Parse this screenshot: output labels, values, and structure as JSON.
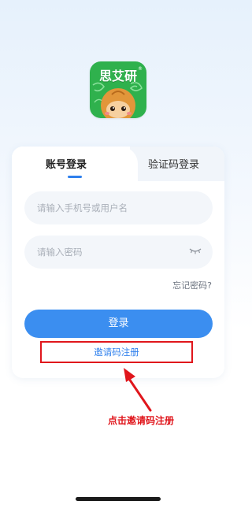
{
  "app": {
    "logo_text": "思艾研",
    "logo_mark": "®",
    "brand_color": "#2fb14d"
  },
  "tabs": {
    "account_login": "账号登录",
    "code_login": "验证码登录",
    "active": "account_login"
  },
  "form": {
    "phone_placeholder": "请输入手机号或用户名",
    "password_placeholder": "请输入密码",
    "forgot_password": "忘记密码?",
    "login_button": "登录",
    "invite_register": "邀请码注册"
  },
  "annotation": {
    "text": "点击邀请码注册",
    "color": "#e0161c"
  },
  "icons": {
    "password_visibility": "eye-closed-icon",
    "annotation_arrow": "arrow-up-icon"
  },
  "colors": {
    "accent": "#3b8ef0",
    "highlight": "#e0161c",
    "field_bg": "#f3f6fa"
  }
}
